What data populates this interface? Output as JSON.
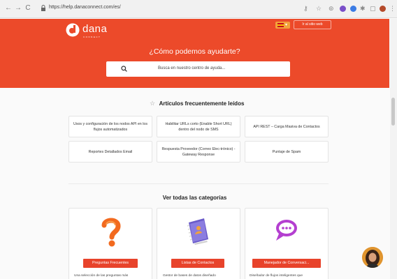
{
  "browser": {
    "url": "https://help.danaconnect.com/es/",
    "icons": [
      "back-icon",
      "forward-icon",
      "reload-icon",
      "lock-icon",
      "key-icon",
      "star-bookmark-icon",
      "extension-icon",
      "extension-icon",
      "extension-icon",
      "puzzle-icon",
      "media-icon",
      "profile-icon",
      "menu-icon"
    ]
  },
  "header": {
    "logo_text": "dana",
    "logo_sub": "CONNECT",
    "visit_label": "Ir al sitio web",
    "title": "¿Cómo podemos ayudarte?",
    "search_placeholder": "Busca en nuestro centro de ayuda...",
    "brand_color": "#ec4a2a"
  },
  "popular": {
    "title": "Artículos frecuentemente leídos",
    "articles": [
      "Usos y configuración de los nodos API en los flujos automatizados",
      "Habilitar URLs corto (Enable Short URL) dentro del nodo de SMS",
      "API REST – Carga Masiva de Contactos",
      "Reportes Detallados Email",
      "Respuesta Proveedor (Correo Elec-trónico) - Gateway Response",
      "Puntaje de Spam"
    ]
  },
  "categories": {
    "title": "Ver todas las categorías",
    "items": [
      {
        "label": "Preguntas Frecuentes",
        "desc": "Una selección de las preguntas más",
        "icon": "question-mark-icon"
      },
      {
        "label": "Listas de Contactos",
        "desc": "Gestor de bases de datos diseñado",
        "icon": "contacts-book-icon"
      },
      {
        "label": "Manejador de Conversaci...",
        "desc": "Diseñador de flujos inteligentes que",
        "icon": "chat-bubble-icon"
      }
    ]
  },
  "chat": {
    "icon": "support-avatar-icon"
  }
}
